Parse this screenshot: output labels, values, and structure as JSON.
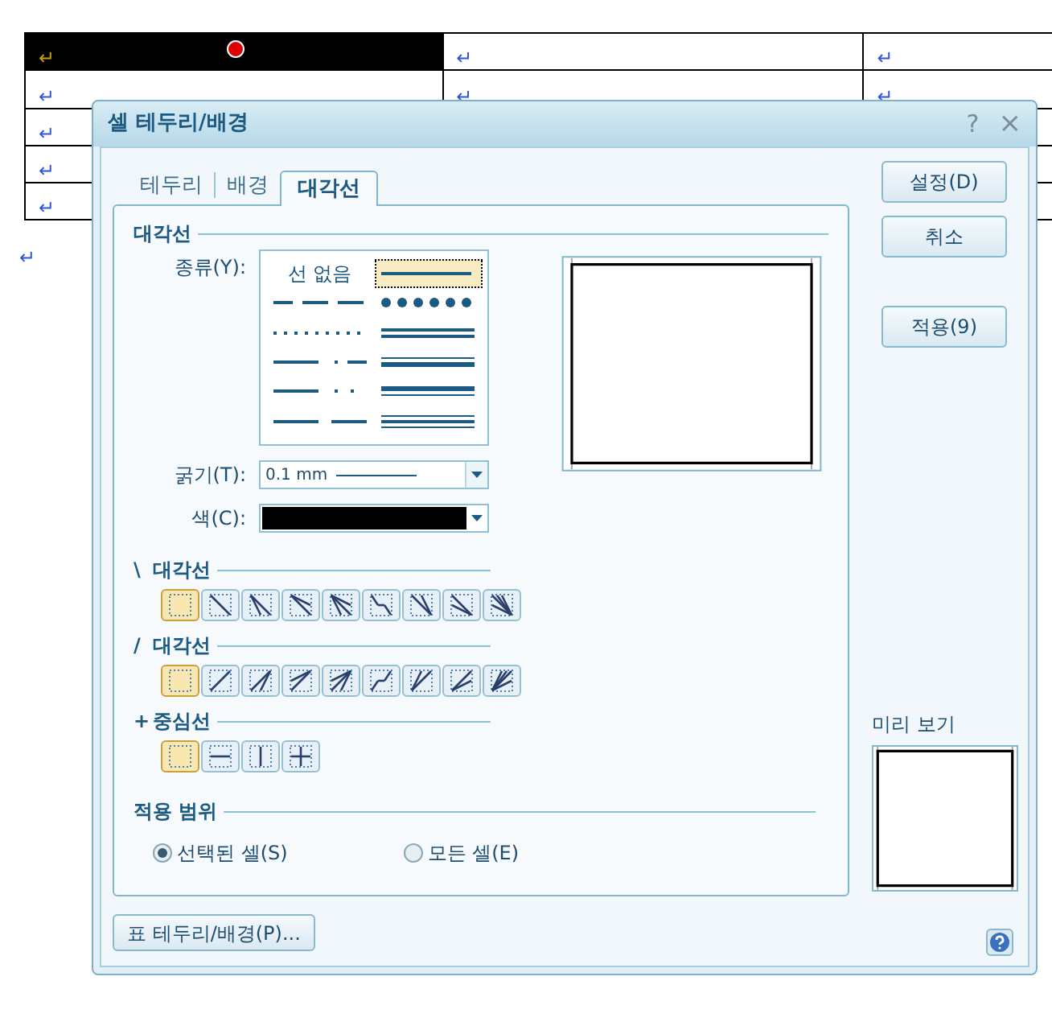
{
  "document": {
    "rows": [
      {
        "cells": [
          {
            "text": "↵",
            "selected": true
          },
          {
            "text": "↵",
            "selected": false
          },
          {
            "text": "↵",
            "selected": false
          }
        ]
      },
      {
        "cells": [
          {
            "text": "↵",
            "selected": false
          },
          {
            "text": "↵",
            "selected": false
          },
          {
            "text": "↵",
            "selected": false
          }
        ]
      },
      {
        "cells": [
          {
            "text": "↵",
            "selected": false
          },
          {},
          {}
        ]
      },
      {
        "cells": [
          {
            "text": "↵",
            "selected": false
          },
          {},
          {}
        ]
      },
      {
        "cells": [
          {
            "text": "↵",
            "selected": false
          },
          {},
          {}
        ]
      }
    ],
    "after_mark": "↵"
  },
  "dialog": {
    "title": "셀 테두리/배경",
    "help": "?",
    "close": "×",
    "tabs": [
      {
        "label": "테두리",
        "selected": false
      },
      {
        "label": "배경",
        "selected": false
      },
      {
        "label": "대각선",
        "selected": true
      }
    ],
    "diagonal": {
      "title": "대각선",
      "type_label": "종류(Y):",
      "line_types": [
        {
          "kind": "none",
          "label": "선 없음",
          "selected": false
        },
        {
          "kind": "solid",
          "selected": true
        },
        {
          "kind": "dash",
          "selected": false
        },
        {
          "kind": "round-dot",
          "selected": false
        },
        {
          "kind": "dot",
          "selected": false
        },
        {
          "kind": "double",
          "selected": false
        },
        {
          "kind": "dash-dot",
          "selected": false
        },
        {
          "kind": "thin-thick",
          "selected": false
        },
        {
          "kind": "dash-dot-dot",
          "selected": false
        },
        {
          "kind": "thick-thin",
          "selected": false
        },
        {
          "kind": "long-dash",
          "selected": false
        },
        {
          "kind": "triple",
          "selected": false
        }
      ],
      "thickness_label": "굵기(T):",
      "thickness": "0.1 mm",
      "color_label": "색(C):",
      "color": "#000000"
    },
    "groups": [
      {
        "symbol": "\\",
        "title": "대각선",
        "kind": "backslash",
        "buttons": [
          {
            "kind": "none",
            "selected": true
          },
          {
            "kind": "single",
            "selected": false
          },
          {
            "kind": "double-a",
            "selected": false
          },
          {
            "kind": "double-b",
            "selected": false
          },
          {
            "kind": "fan",
            "selected": false
          },
          {
            "kind": "step",
            "selected": false
          },
          {
            "kind": "double-c",
            "selected": false
          },
          {
            "kind": "double-d",
            "selected": false
          },
          {
            "kind": "fan-wide",
            "selected": false
          }
        ]
      },
      {
        "symbol": "/",
        "title": "대각선",
        "kind": "slash",
        "buttons": [
          {
            "kind": "none",
            "selected": true
          },
          {
            "kind": "single",
            "selected": false
          },
          {
            "kind": "double-a",
            "selected": false
          },
          {
            "kind": "double-b",
            "selected": false
          },
          {
            "kind": "fan",
            "selected": false
          },
          {
            "kind": "step",
            "selected": false
          },
          {
            "kind": "double-c",
            "selected": false
          },
          {
            "kind": "double-d",
            "selected": false
          },
          {
            "kind": "fan-wide",
            "selected": false
          }
        ]
      },
      {
        "symbol": "+",
        "title": "중심선",
        "kind": "center",
        "buttons": [
          {
            "kind": "none",
            "selected": true
          },
          {
            "kind": "horizontal",
            "selected": false
          },
          {
            "kind": "vertical",
            "selected": false
          },
          {
            "kind": "cross",
            "selected": false
          }
        ]
      }
    ],
    "scope": {
      "title": "적용 범위",
      "options": [
        {
          "label": "선택된 셀(S)",
          "selected": true
        },
        {
          "label": "모든 셀(E)",
          "selected": false
        }
      ]
    },
    "buttons": [
      "설정(D)",
      "취소",
      "적용(9)"
    ],
    "preview_label": "미리 보기",
    "table_button": "표 테두리/배경(P)..."
  }
}
